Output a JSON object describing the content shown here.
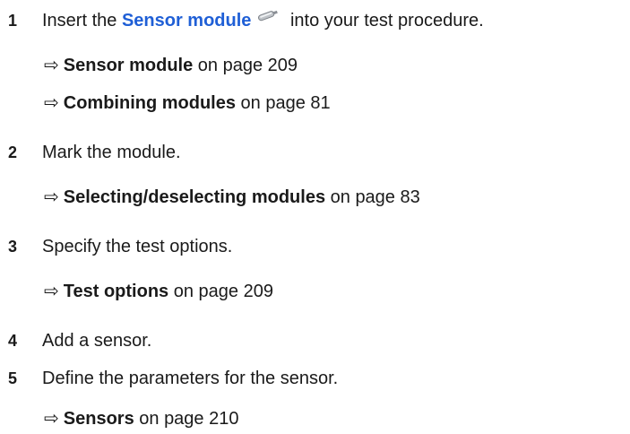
{
  "steps": [
    {
      "number": "1",
      "text_before": "Insert the ",
      "link": "Sensor module",
      "text_after": " into your test procedure.",
      "icon": "sensor-icon",
      "refs": [
        {
          "arrow": "⇨",
          "title": "Sensor module",
          "page_text": " on page 209"
        },
        {
          "arrow": "⇨",
          "title": "Combining modules",
          "page_text": " on page 81"
        }
      ]
    },
    {
      "number": "2",
      "text": "Mark the module.",
      "refs": [
        {
          "arrow": "⇨",
          "title": "Selecting/deselecting modules",
          "page_text": " on page 83"
        }
      ]
    },
    {
      "number": "3",
      "text": "Specify the test options.",
      "refs": [
        {
          "arrow": "⇨",
          "title": "Test options",
          "page_text": " on page 209"
        }
      ]
    },
    {
      "number": "4",
      "text": "Add a sensor.",
      "refs": []
    },
    {
      "number": "5",
      "text": "Define the parameters for the sensor.",
      "refs": [
        {
          "arrow": "⇨",
          "title": "Sensors",
          "page_text": " on page 210"
        }
      ]
    }
  ],
  "colors": {
    "link": "#1f5fd6",
    "text": "#1a1a1a"
  }
}
